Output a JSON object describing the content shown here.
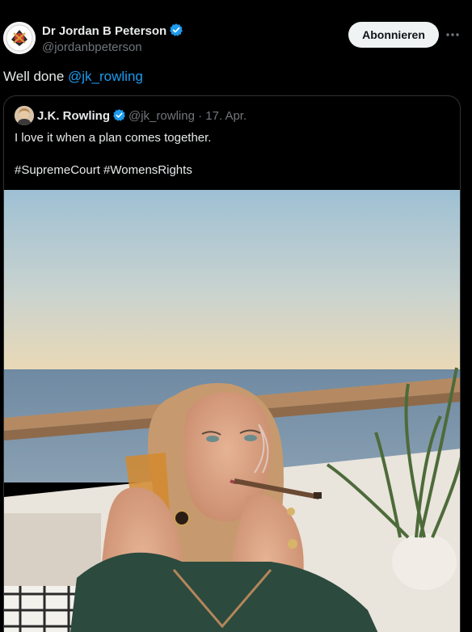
{
  "author": {
    "name": "Dr Jordan B Peterson",
    "handle": "@jordanbpeterson",
    "verified_icon": "verified-badge-icon"
  },
  "actions": {
    "subscribe_label": "Abonnieren"
  },
  "post": {
    "text_prefix": "Well done ",
    "mention": "@jk_rowling"
  },
  "quoted_post": {
    "author_name": "J.K. Rowling",
    "handle": "@jk_rowling",
    "separator": " · ",
    "date": "17. Apr.",
    "text": "I love it when a plan comes together.",
    "hashtags": "#SupremeCourt #WomensRights",
    "image_description_icon": "photo-icon"
  },
  "colors": {
    "background": "#000000",
    "text": "#e7e9ea",
    "muted": "#71767b",
    "link": "#1d9bf0",
    "border": "#2f3336",
    "button_bg": "#eff3f4"
  }
}
